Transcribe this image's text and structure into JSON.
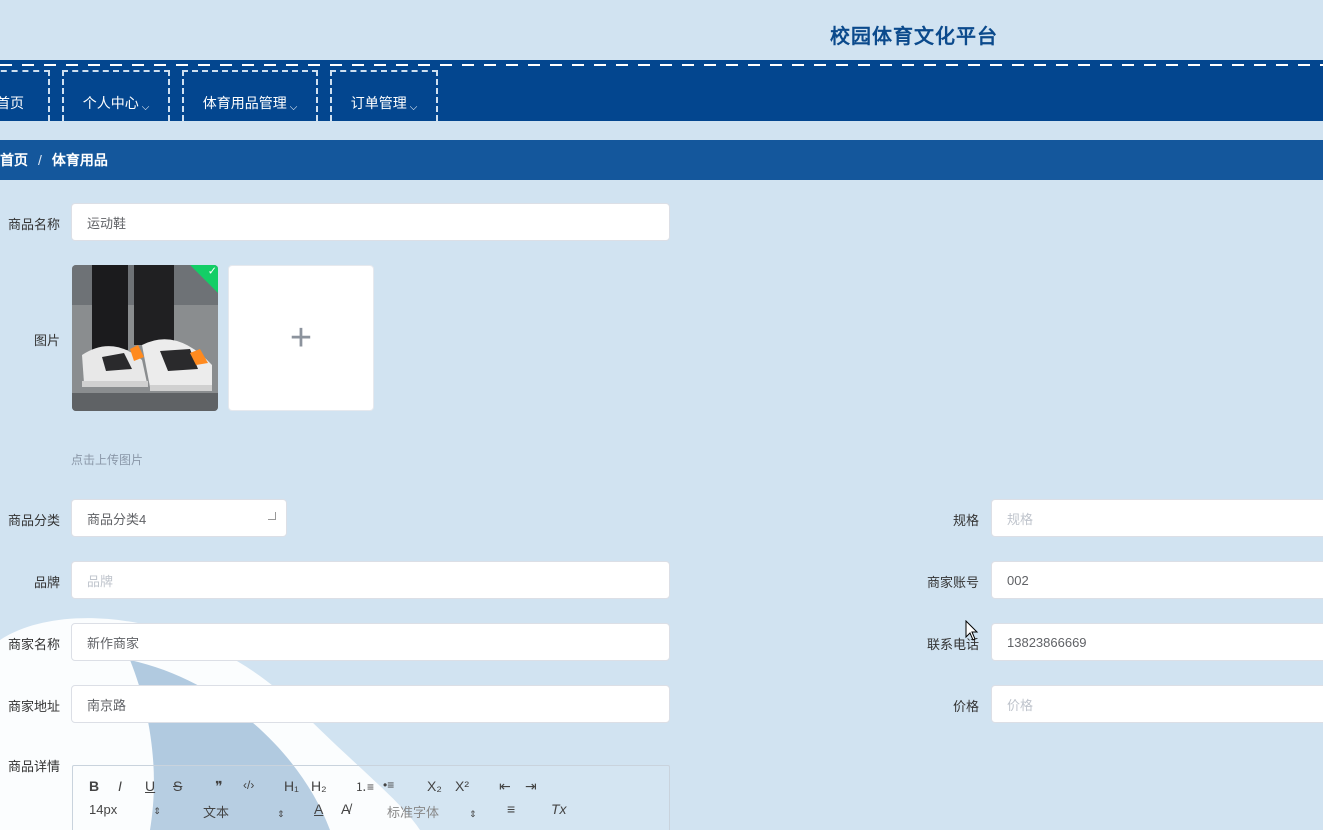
{
  "site": {
    "title": "校园体育文化平台"
  },
  "nav": {
    "items": [
      {
        "label": "首页"
      },
      {
        "label": "个人中心"
      },
      {
        "label": "体育用品管理"
      },
      {
        "label": "订单管理"
      }
    ],
    "chevron": "⌵"
  },
  "breadcrumb": {
    "home": "首页",
    "separator": "/",
    "current": "体育用品"
  },
  "form": {
    "name_label": "商品名称",
    "name_value": "运动鞋",
    "image_label": "图片",
    "upload_hint": "点击上传图片",
    "upload_plus": "+",
    "category_label": "商品分类",
    "category_value": "商品分类4",
    "spec_label": "规格",
    "spec_placeholder": "规格",
    "brand_label": "品牌",
    "brand_placeholder": "品牌",
    "merchant_account_label": "商家账号",
    "merchant_account_value": "002",
    "merchant_name_label": "商家名称",
    "merchant_name_value": "新作商家",
    "phone_label": "联系电话",
    "phone_value": "13823866669",
    "address_label": "商家地址",
    "address_value": "南京路",
    "price_label": "价格",
    "price_placeholder": "价格",
    "details_label": "商品详情"
  },
  "editor": {
    "bold": "B",
    "italic": "I",
    "underline": "U",
    "strike": "S",
    "quote": "❞",
    "code": "‹/›",
    "h1": "H₁",
    "h2": "H₂",
    "ordered": "⒈≡",
    "bullet": "•≡",
    "sub": "X₂",
    "sup": "X²",
    "outdent": "⇤",
    "indent": "⇥",
    "size_value": "14px",
    "header_value": "文本",
    "font_value": "标准字体",
    "color": "A",
    "bg": "A̸",
    "align": "≡",
    "clean": "Tx"
  },
  "colors": {
    "nav_bg": "#03468f",
    "breadcrumb_bg": "#14579c",
    "title": "#0b4a8c",
    "page_bg": "#d1e3f1",
    "check": "#13ce66"
  }
}
